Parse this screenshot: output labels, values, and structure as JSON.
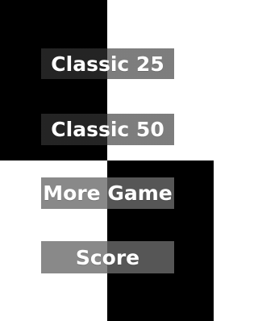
{
  "game": {
    "tiles": {
      "top_left_color": "#000000",
      "top_right_color": "#ffffff",
      "bottom_left_color": "#ffffff",
      "bottom_right_color": "#000000"
    },
    "menu": {
      "classic_25_label": "Classic 25",
      "classic_50_label": "Classic 50",
      "more_game_label": "More Game",
      "score_label": "Score"
    }
  }
}
